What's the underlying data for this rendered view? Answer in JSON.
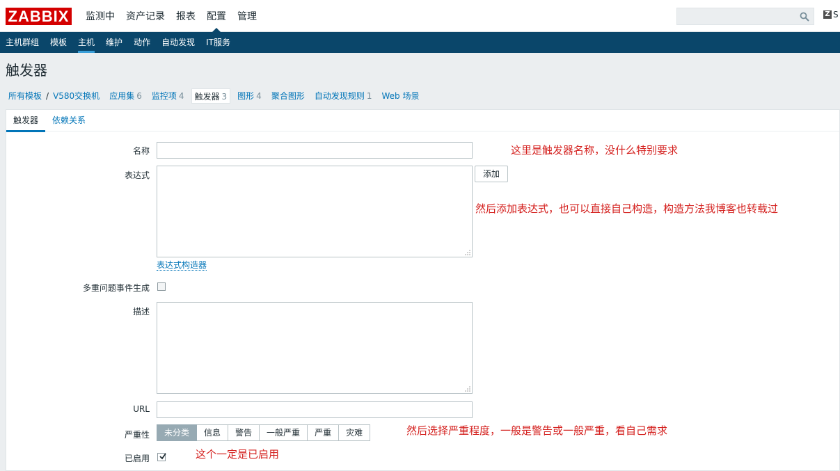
{
  "app": {
    "logo": "ZABBIX"
  },
  "topnav": [
    "监测中",
    "资产记录",
    "报表",
    "配置",
    "管理"
  ],
  "topnav_active": "配置",
  "share_label": "S",
  "subnav": [
    "主机群组",
    "模板",
    "主机",
    "维护",
    "动作",
    "自动发现",
    "IT服务"
  ],
  "page_title": "触发器",
  "breadcrumb": {
    "root": "所有模板",
    "host": "V580交换机",
    "tabs": [
      {
        "label": "应用集",
        "count": "6"
      },
      {
        "label": "监控项",
        "count": "4"
      },
      {
        "label": "触发器",
        "count": "3",
        "active": true
      },
      {
        "label": "图形",
        "count": "4"
      },
      {
        "label": "聚合图形",
        "count": ""
      },
      {
        "label": "自动发现规则",
        "count": "1"
      },
      {
        "label": "Web 场景",
        "count": ""
      }
    ]
  },
  "form_tabs": [
    "触发器",
    "依赖关系"
  ],
  "form": {
    "name_label": "名称",
    "name_value": "",
    "expression_label": "表达式",
    "expression_value": "",
    "add_button": "添加",
    "expression_constructor": "表达式构造器",
    "multiple_events_label": "多重问题事件生成",
    "description_label": "描述",
    "description_value": "",
    "url_label": "URL",
    "url_value": "",
    "severity_label": "严重性",
    "severity_options": [
      "未分类",
      "信息",
      "警告",
      "一般严重",
      "严重",
      "灾难"
    ],
    "severity_selected": "未分类",
    "enabled_label": "已启用",
    "enabled": true
  },
  "annotations": {
    "name_note": "这里是触发器名称，没什么特别要求",
    "expression_note": "然后添加表达式，也可以直接自己构造，构造方法我博客也转载过",
    "severity_note": "然后选择严重程度，一般是警告或一般严重，看自己需求",
    "enabled_note": "这个一定是已启用"
  },
  "colors": {
    "brand": "#d40000",
    "subnav_bg": "#0a466a",
    "link": "#0275b8",
    "annotation": "#d4201e"
  }
}
